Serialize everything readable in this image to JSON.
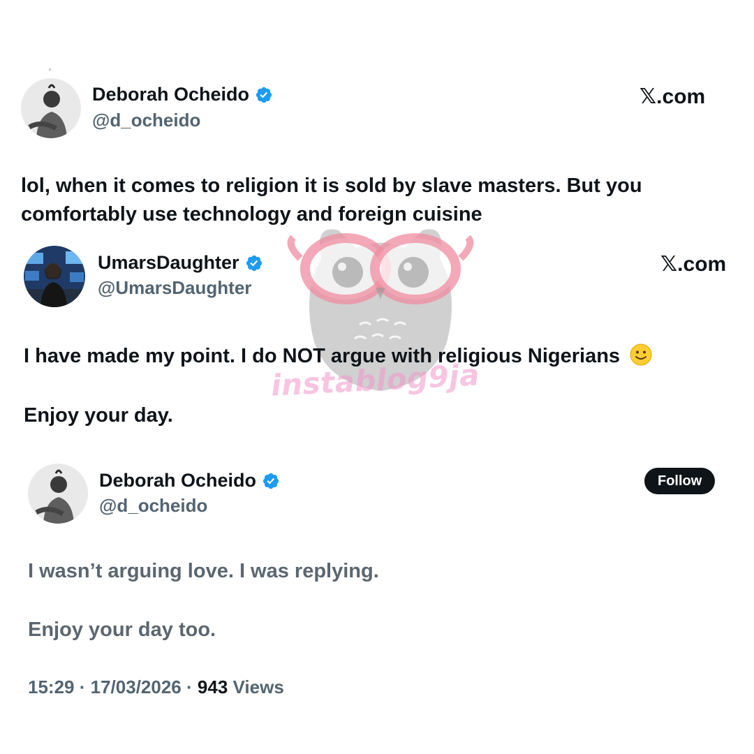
{
  "tweet1": {
    "display_name": "Deborah Ocheido",
    "handle": "@d_ocheido",
    "source_label": ".com",
    "source_glyph": "𝕏",
    "text_line1": "lol, when it comes to religion it is sold by slave masters. But you",
    "text_line2": "comfortably use technology and foreign cuisine"
  },
  "tweet2": {
    "display_name": "UmarsDaughter",
    "handle": "@UmarsDaughter",
    "source_label": ".com",
    "source_glyph": "𝕏",
    "text_line1": "I have made my point. I do NOT argue with religious Nigerians",
    "text_line2": "Enjoy your day."
  },
  "tweet3": {
    "display_name": "Deborah Ocheido",
    "handle": "@d_ocheido",
    "follow_label": "Follow",
    "text_line1": "I wasn’t arguing love. I was replying.",
    "text_line2": "Enjoy your day too.",
    "time": "15:29",
    "date": "17/03/2026",
    "separator": "·",
    "views_count": "943",
    "views_label": "Views"
  },
  "watermark": {
    "text": "instablog9ja"
  },
  "icons": {
    "verified": "verified-badge-icon",
    "emoji": "slightly-smiling-face-emoji"
  },
  "colors": {
    "verified_blue": "#1d9bf0",
    "text_primary": "#0f1419",
    "text_secondary": "#536471",
    "follow_bg": "#0f1419"
  }
}
